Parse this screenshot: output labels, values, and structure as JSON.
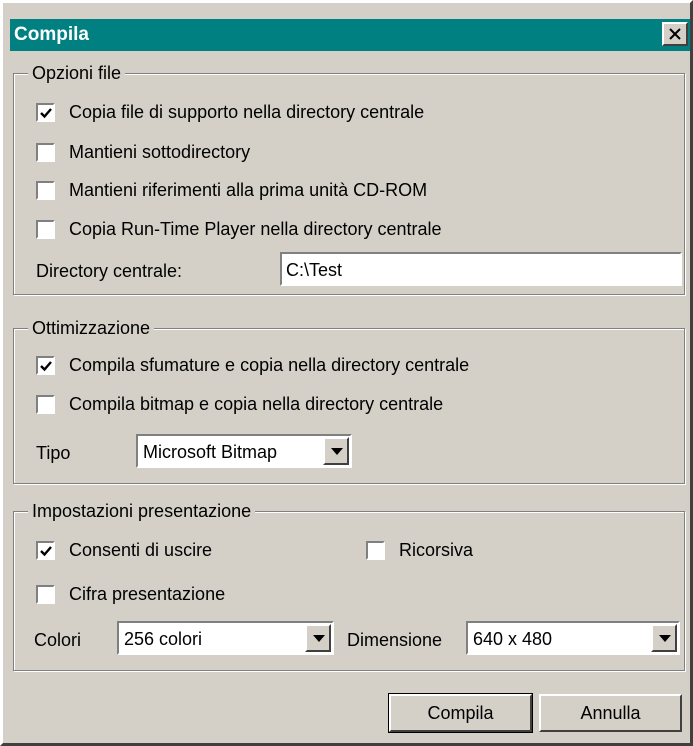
{
  "window": {
    "title": "Compila"
  },
  "file_options": {
    "legend": "Opzioni file",
    "items": [
      {
        "label": "Copia file di supporto nella directory centrale",
        "checked": true
      },
      {
        "label": "Mantieni sottodirectory",
        "checked": false
      },
      {
        "label": "Mantieni riferimenti alla prima unità CD-ROM",
        "checked": false
      },
      {
        "label": "Copia Run-Time Player nella directory centrale",
        "checked": false
      }
    ],
    "directory_label": "Directory centrale:",
    "directory_value": "C:\\Test"
  },
  "optimization": {
    "legend": "Ottimizzazione",
    "items": [
      {
        "label": "Compila sfumature e copia nella directory centrale",
        "checked": true
      },
      {
        "label": "Compila bitmap e copia nella directory centrale",
        "checked": false
      }
    ],
    "type_label": "Tipo",
    "type_value": "Microsoft Bitmap"
  },
  "presentation": {
    "legend": "Impostazioni presentazione",
    "allow_exit": {
      "label": "Consenti di uscire",
      "checked": true
    },
    "recursive": {
      "label": "Ricorsiva",
      "checked": false
    },
    "encrypt": {
      "label": "Cifra presentazione",
      "checked": false
    },
    "colors_label": "Colori",
    "colors_value": "256 colori",
    "size_label": "Dimensione",
    "size_value": "640 x 480"
  },
  "buttons": {
    "compile": "Compila",
    "cancel": "Annulla"
  }
}
